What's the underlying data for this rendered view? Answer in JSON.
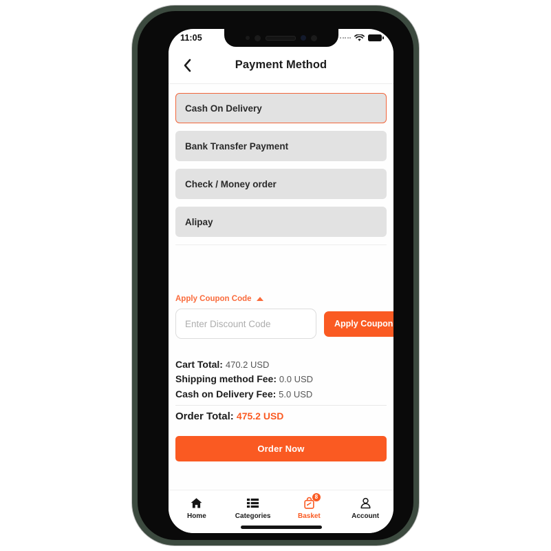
{
  "status_bar": {
    "time": "11:05",
    "wifi_icon": "wifi-icon",
    "battery_icon": "battery-full-icon",
    "signal_icon": "signal-dots-icon"
  },
  "header": {
    "title": "Payment Method",
    "back_icon": "chevron-left-icon"
  },
  "payment_methods": [
    {
      "label": "Cash On Delivery",
      "selected": true
    },
    {
      "label": "Bank Transfer Payment",
      "selected": false
    },
    {
      "label": "Check / Money order",
      "selected": false
    },
    {
      "label": "Alipay",
      "selected": false
    }
  ],
  "coupon": {
    "toggle_label": "Apply Coupon Code",
    "toggle_icon": "caret-up-icon",
    "input_value": "",
    "input_placeholder": "Enter Discount Code",
    "apply_label": "Apply Coupon"
  },
  "totals": {
    "rows": [
      {
        "label": "Cart Total:",
        "value": "470.2 USD"
      },
      {
        "label": "Shipping method Fee:",
        "value": "0.0 USD"
      },
      {
        "label": "Cash on Delivery Fee:",
        "value": "5.0 USD"
      }
    ],
    "order_total": {
      "label": "Order Total:",
      "value": "475.2 USD"
    }
  },
  "order_now_label": "Order Now",
  "bottom_nav": [
    {
      "label": "Home",
      "icon": "home-icon",
      "active": false
    },
    {
      "label": "Categories",
      "icon": "list-icon",
      "active": false
    },
    {
      "label": "Basket",
      "icon": "basket-icon",
      "active": true,
      "badge": "8"
    },
    {
      "label": "Account",
      "icon": "user-icon",
      "active": false
    }
  ],
  "colors": {
    "accent": "#fa5a22",
    "accent_light": "#fa6b3c",
    "option_bg": "#e2e2e2",
    "text": "#1c1c1c",
    "frame": "#3c4a3f"
  }
}
